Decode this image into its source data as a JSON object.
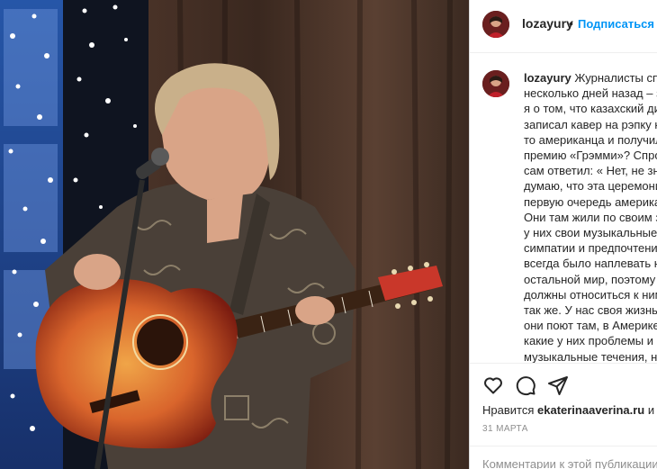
{
  "post": {
    "username": "lozayury",
    "follow_label": "Подписаться",
    "separator": "•",
    "caption": "Журналисты спросили несколько дней назад – знаю ли я о том, что казахский диджей записал кавер на рэпку какого-то американца и получил за это премию «Грэмми»? Спросил и сам ответил: « Нет, не знаю, но думаю, что эта церемония в первую очередь американская. Они там жили по своим законам, у них свои музыкальные симпатии и предпочтения. Им всегда было наплевать на остальной мир, поэтому мы должны относиться к ним точно так же. У нас своя жизнь и что они поют там, в Америке, и какие у них проблемы и музыкальные течения, нас должно волновать в самую последнюю очередь. Поэтому и этот диджей",
    "likes_prefix": "Нравится",
    "likes_user": "ekaterinaaverina.ru",
    "likes_suffix": "и др",
    "date": "31 МАРТА",
    "comment_placeholder": "Комментарии к этой публикации"
  },
  "icons": {
    "like": "heart-icon",
    "comment": "comment-icon",
    "share": "share-icon"
  },
  "colors": {
    "follow": "#0095f6",
    "text": "#262626",
    "muted": "#8e8e8e",
    "border": "#efefef"
  }
}
